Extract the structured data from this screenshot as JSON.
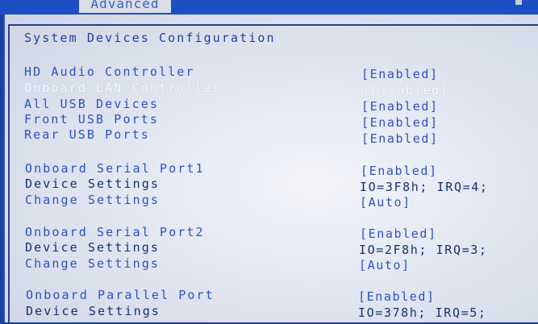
{
  "header": {
    "active_tab": "Advanced"
  },
  "section_title": "System Devices Configuration",
  "items": [
    {
      "label": "HD Audio Controller",
      "value": "[Enabled]"
    },
    {
      "label": "Onboard LAN Controller",
      "value": "[Disabled]"
    },
    {
      "label": "All USB Devices",
      "value": "[Enabled]"
    },
    {
      "label": "Front USB Ports",
      "value": "[Enabled]"
    },
    {
      "label": "Rear USB Ports",
      "value": "[Enabled]"
    },
    {
      "label": "Onboard Serial Port1",
      "value": "[Enabled]"
    },
    {
      "label": "Device Settings",
      "value": "IO=3F8h; IRQ=4;"
    },
    {
      "label": "Change Settings",
      "value": "[Auto]"
    },
    {
      "label": "Onboard Serial Port2",
      "value": "[Enabled]"
    },
    {
      "label": "Device Settings",
      "value": "IO=2F8h; IRQ=3;"
    },
    {
      "label": "Change Settings",
      "value": "[Auto]"
    },
    {
      "label": "Onboard Parallel Port",
      "value": "[Enabled]"
    },
    {
      "label": "Device Settings",
      "value": "IO=378h; IRQ=5;"
    }
  ],
  "colors": {
    "bios_blue": "#1b3fa0",
    "label_blue": "#2b52c8",
    "highlight": "#ffffff",
    "panel": "#e2e6f1"
  }
}
